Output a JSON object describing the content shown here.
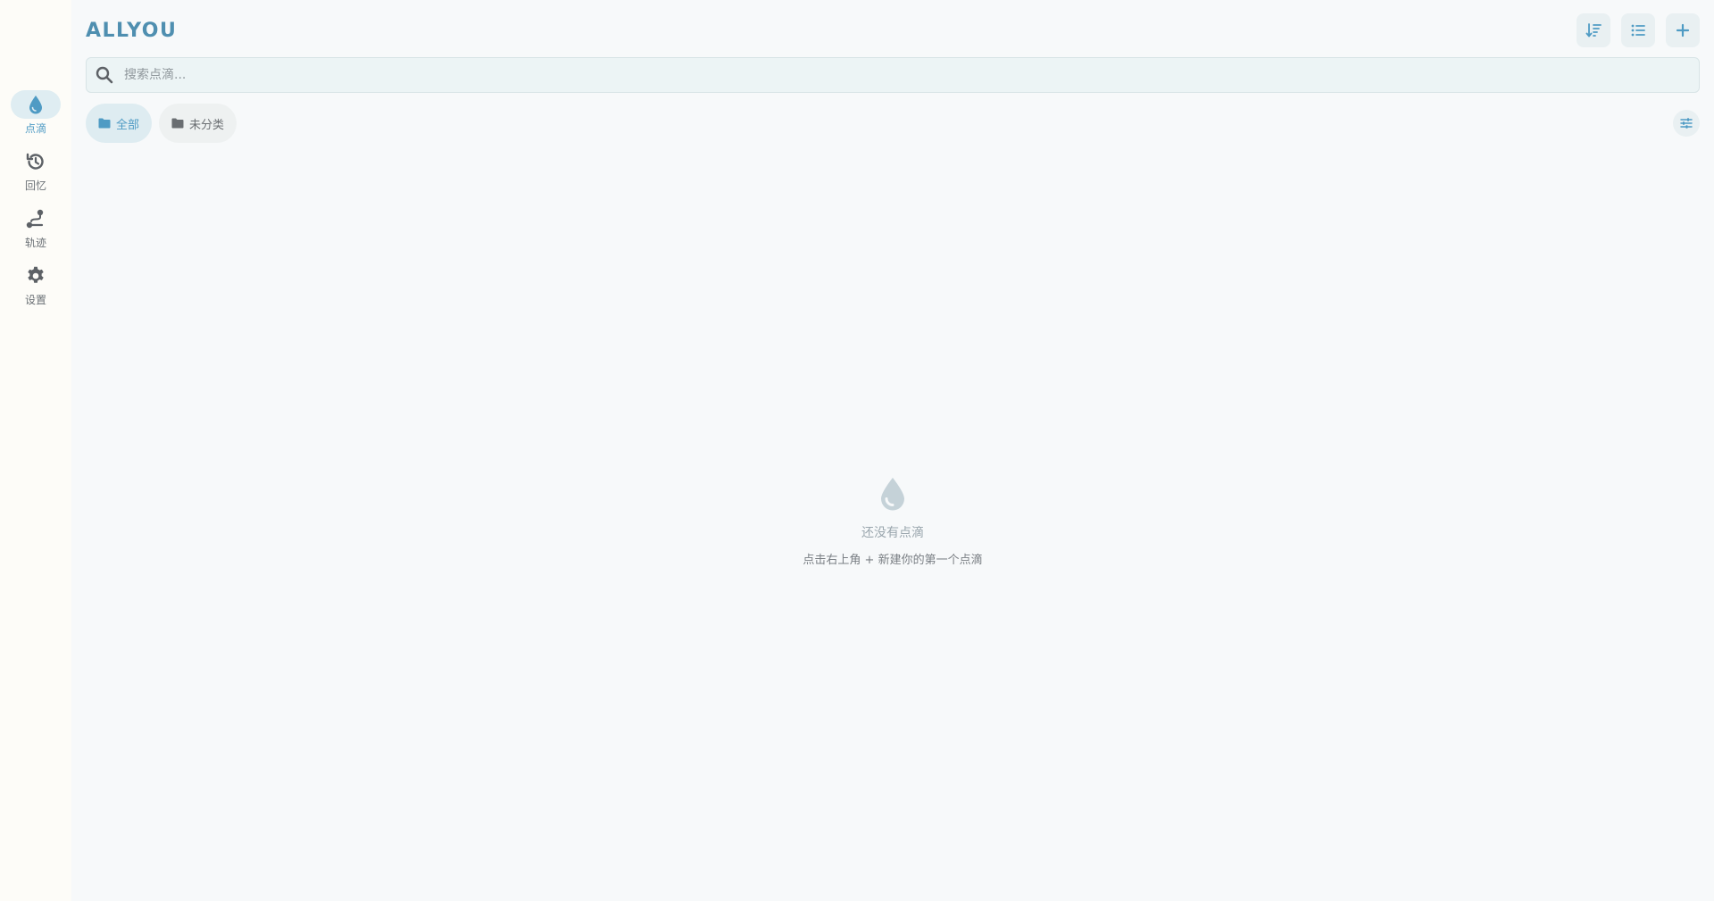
{
  "sidebar": {
    "items": [
      {
        "label": "点滴",
        "icon": "drop-icon",
        "active": true
      },
      {
        "label": "回忆",
        "icon": "history-icon",
        "active": false
      },
      {
        "label": "轨迹",
        "icon": "route-icon",
        "active": false
      },
      {
        "label": "设置",
        "icon": "gear-icon",
        "active": false
      }
    ]
  },
  "header": {
    "brand": "ALLYOU",
    "actions": [
      {
        "icon": "sort-icon"
      },
      {
        "icon": "list-icon"
      },
      {
        "icon": "plus-icon"
      }
    ]
  },
  "search": {
    "placeholder": "搜索点滴...",
    "value": ""
  },
  "filters": {
    "chips": [
      {
        "label": "全部",
        "icon": "folder-icon",
        "active": true
      },
      {
        "label": "未分类",
        "icon": "folder-icon",
        "active": false
      }
    ],
    "settings_icon": "sliders-icon"
  },
  "empty_state": {
    "icon": "drop-icon",
    "title": "还没有点滴",
    "hint": "点击右上角 + 新建你的第一个点滴"
  },
  "colors": {
    "accent": "#4f9bc4",
    "brand": "#4f8fb0",
    "muted_icon": "#5d6166",
    "empty_icon": "#c5d2d8"
  }
}
